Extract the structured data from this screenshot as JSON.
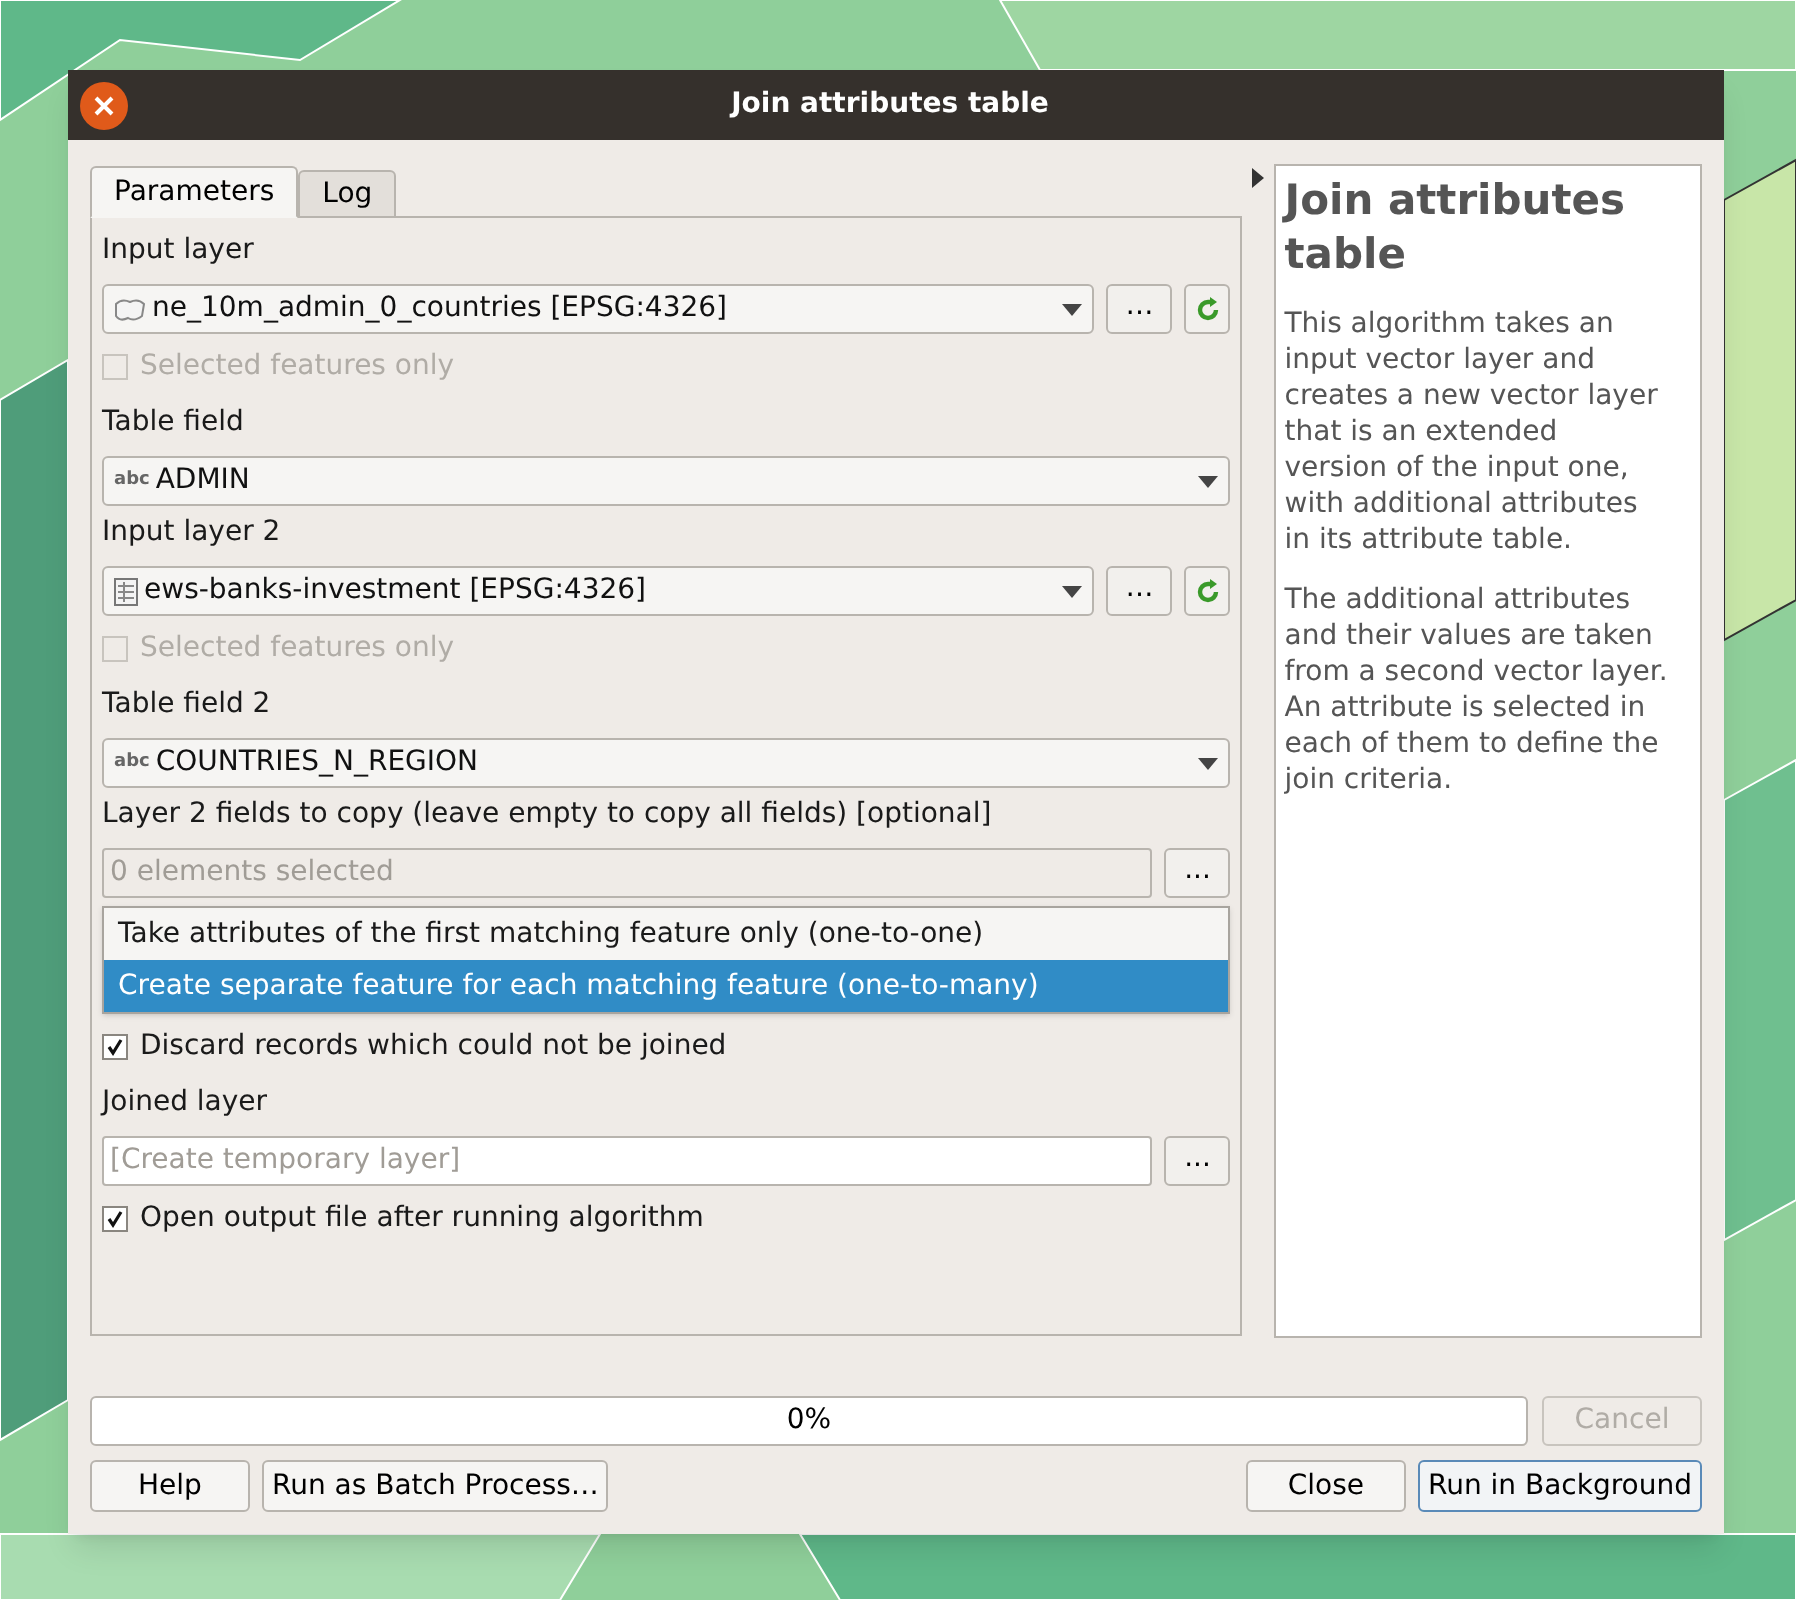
{
  "window": {
    "title": "Join attributes table"
  },
  "tabs": [
    {
      "label": "Parameters",
      "selected": true
    },
    {
      "label": "Log",
      "selected": false
    }
  ],
  "params": [
    {
      "kind": "label",
      "text": "Input layer"
    },
    {
      "kind": "layer",
      "value": "ne_10m_admin_0_countries [EPSG:4326]",
      "browse": "…"
    },
    {
      "kind": "checkbox",
      "text": "Selected features only",
      "checked": false,
      "disabled": true
    },
    {
      "kind": "label",
      "text": "Table field"
    },
    {
      "kind": "field",
      "prefix": "abc",
      "value": "ADMIN"
    },
    {
      "kind": "label",
      "text": "Input layer 2"
    },
    {
      "kind": "layer",
      "value": "ews-banks-investment [EPSG:4326]",
      "browse": "…"
    },
    {
      "kind": "checkbox",
      "text": "Selected features only",
      "checked": false,
      "disabled": true
    },
    {
      "kind": "label",
      "text": "Table field 2"
    },
    {
      "kind": "field",
      "prefix": "abc",
      "value": "COUNTRIES_N_REGION"
    },
    {
      "kind": "label",
      "text": "Layer 2 fields to copy (leave empty to copy all fields) [optional]"
    },
    {
      "kind": "multi",
      "placeholder": "0 elements selected",
      "browse": "..."
    },
    {
      "kind": "options",
      "options": [
        {
          "text": "Take attributes of the first matching feature only (one-to-one)",
          "selected": false
        },
        {
          "text": "Create separate feature for each matching feature (one-to-many)",
          "selected": true
        }
      ]
    },
    {
      "kind": "checkbox",
      "text": "Discard records which could not be joined",
      "checked": true,
      "disabled": false
    },
    {
      "kind": "label",
      "text": "Joined layer"
    },
    {
      "kind": "output",
      "placeholder": "[Create temporary layer]",
      "browse": "..."
    },
    {
      "kind": "checkbox",
      "text": "Open output file after running algorithm",
      "checked": true,
      "disabled": false
    }
  ],
  "help": {
    "title": "Join attributes table",
    "paragraphs": [
      "This algorithm takes an input vector layer and creates a new vector layer that is an extended version of the input one, with additional attributes in its attribute table.",
      "The additional attributes and their values are taken from a second vector layer. An attribute is selected in each of them to define the join criteria."
    ]
  },
  "progress": {
    "level": 0,
    "text": "0%"
  },
  "cancel": {
    "label": "Cancel",
    "disabled": true
  },
  "buttons_left": [
    "Help",
    "Run as Batch Process…"
  ],
  "buttons_right": [
    {
      "label": "Close",
      "default": false
    },
    {
      "label": "Run in Background",
      "default": true
    }
  ]
}
